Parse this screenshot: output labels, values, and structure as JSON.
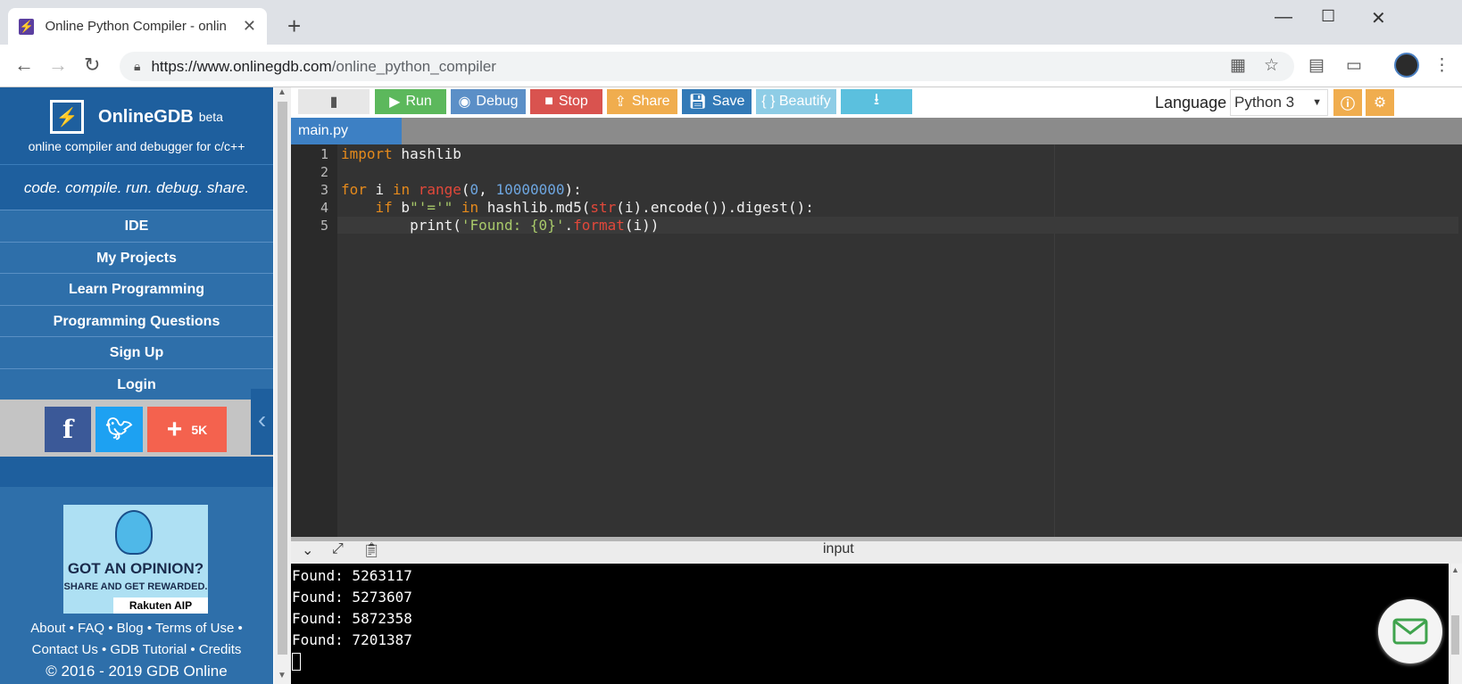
{
  "browser": {
    "tab_title": "Online Python Compiler - onlin",
    "tab_close": "✕",
    "new_tab": "+",
    "url_host": "https://www.onlinegdb.com",
    "url_path": "/online_python_compiler"
  },
  "sidebar": {
    "brand": "OnlineGDB",
    "beta": "beta",
    "subtitle": "online compiler and debugger for c/c++",
    "tagline": "code. compile. run. debug. share.",
    "nav": [
      "IDE",
      "My Projects",
      "Learn Programming",
      "Programming Questions",
      "Sign Up",
      "Login"
    ],
    "share_count": "5K",
    "ad": {
      "headline": "GOT AN OPINION?",
      "sub": "SHARE AND GET REWARDED.",
      "brand": "Rakuten AIP"
    },
    "footer_line1": "About • FAQ • Blog • Terms of Use •",
    "footer_line2": "Contact Us • GDB Tutorial • Credits",
    "copyright": "© 2016 - 2019 GDB Online"
  },
  "toolbar": {
    "run": "Run",
    "debug": "Debug",
    "stop": "Stop",
    "share": "Share",
    "save": "Save",
    "beautify": "{ } Beautify",
    "language_label": "Language",
    "language_value": "Python 3"
  },
  "editor": {
    "file_tab": "main.py",
    "line_numbers": [
      "1",
      "2",
      "3",
      "4",
      "5"
    ]
  },
  "console": {
    "label": "input",
    "output": [
      "Found:  5263117",
      "Found:  5273607",
      "Found:  5872358",
      "Found:  7201387"
    ]
  },
  "colors": {
    "accent": "#2e6faa",
    "run": "#5cb85c",
    "stop": "#d9534f",
    "share": "#f0ad4e"
  }
}
